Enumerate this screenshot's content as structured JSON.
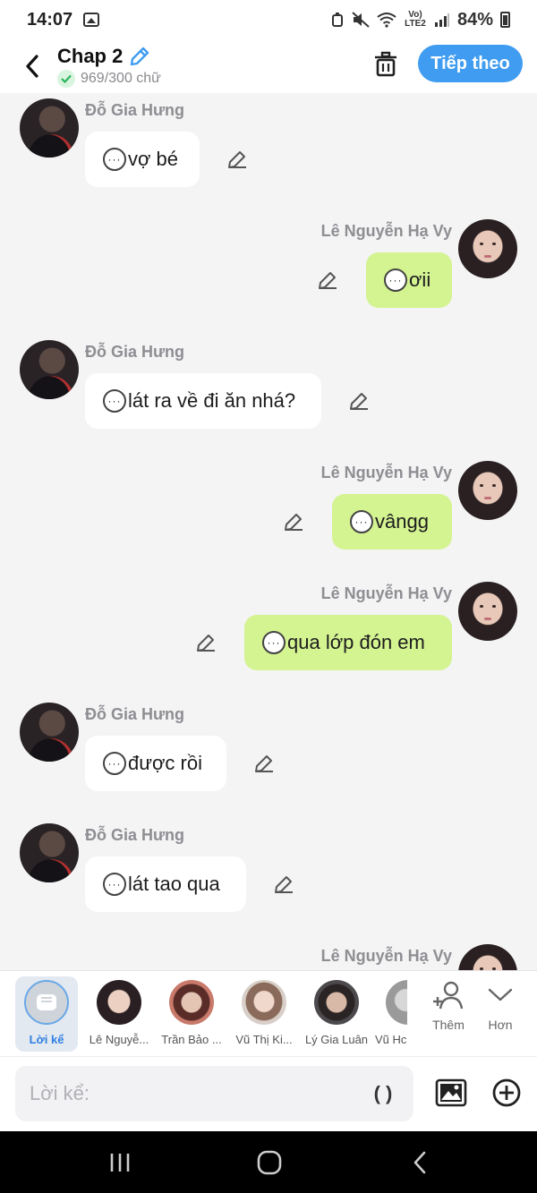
{
  "status": {
    "time": "14:07",
    "network": "Vo) LTE2",
    "battery": "84%"
  },
  "header": {
    "title": "Chap 2",
    "word_count": "969/300 chữ",
    "next_label": "Tiếp theo"
  },
  "messages": [
    {
      "sender": "Đỗ Gia Hưng",
      "text": "vợ bé",
      "side": "in"
    },
    {
      "sender": "Lê Nguyễn Hạ Vy",
      "text": "ơii",
      "side": "out"
    },
    {
      "sender": "Đỗ Gia Hưng",
      "text": "lát ra về đi ăn nhá?",
      "side": "in"
    },
    {
      "sender": "Lê Nguyễn Hạ Vy",
      "text": "vângg",
      "side": "out"
    },
    {
      "sender": "Lê Nguyễn Hạ Vy",
      "text": "qua lớp đón em",
      "side": "out"
    },
    {
      "sender": "Đỗ Gia Hưng",
      "text": "được rồi",
      "side": "in"
    },
    {
      "sender": "Đỗ Gia Hưng",
      "text": "lát tao qua",
      "side": "in"
    },
    {
      "sender": "Lê Nguyễn Hạ Vy",
      "text": "",
      "side": "out"
    }
  ],
  "characters": [
    {
      "name": "Lời kể",
      "selected": true
    },
    {
      "name": "Lê Nguyễ..."
    },
    {
      "name": "Trần Bảo ..."
    },
    {
      "name": "Vũ Thị Ki..."
    },
    {
      "name": "Lý Gia Luân"
    },
    {
      "name": "Vũ Hc"
    }
  ],
  "char_actions": {
    "more_label": "Thêm",
    "expand_label": "Hơn"
  },
  "input": {
    "placeholder": "Lời kể:",
    "paren_label": "( )"
  },
  "colors": {
    "accent": "#3f9cf0",
    "outgoing_bubble": "#d4f391",
    "incoming_bubble": "#ffffff",
    "background": "#f4f4f5"
  },
  "icons": {
    "back": "chevron-left-icon",
    "edit_title": "pencil-icon",
    "trash": "trash-icon",
    "message_edit": "pencil-icon",
    "speech": "speech-bubble-dots-icon",
    "add_character": "add-person-icon",
    "expand": "chevron-down-icon",
    "image": "image-icon",
    "plus": "plus-circle-icon"
  }
}
